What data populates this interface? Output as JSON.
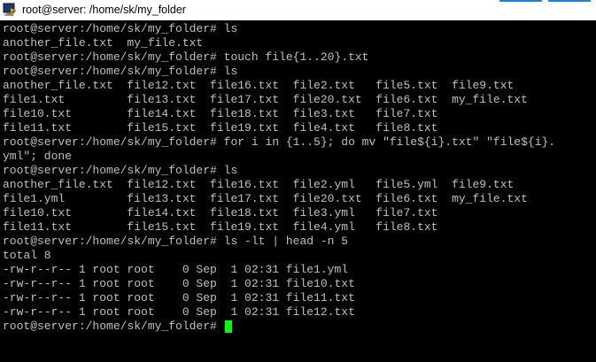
{
  "window": {
    "title": "root@server: /home/sk/my_folder",
    "accent_color": "#1f7fd6",
    "icon": "putty-terminal-icon"
  },
  "terminal": {
    "text_color": "#c0c0c0",
    "background": "#000000",
    "cursor_color": "#00ff00",
    "lines": [
      "root@server:/home/sk/my_folder# ls",
      "another_file.txt  my_file.txt",
      "root@server:/home/sk/my_folder# touch file{1..20}.txt",
      "root@server:/home/sk/my_folder# ls",
      "another_file.txt  file12.txt  file16.txt  file2.txt   file5.txt  file9.txt",
      "file1.txt         file13.txt  file17.txt  file20.txt  file6.txt  my_file.txt",
      "file10.txt        file14.txt  file18.txt  file3.txt   file7.txt",
      "file11.txt        file15.txt  file19.txt  file4.txt   file8.txt",
      "root@server:/home/sk/my_folder# for i in {1..5}; do mv \"file${i}.txt\" \"file${i}.",
      "yml\"; done",
      "root@server:/home/sk/my_folder# ls",
      "another_file.txt  file12.txt  file16.txt  file2.yml   file5.yml  file9.txt",
      "file1.yml         file13.txt  file17.txt  file20.txt  file6.txt  my_file.txt",
      "file10.txt        file14.txt  file18.txt  file3.yml   file7.txt",
      "file11.txt        file15.txt  file19.txt  file4.yml   file8.txt",
      "root@server:/home/sk/my_folder# ls -lt | head -n 5",
      "total 8",
      "-rw-r--r-- 1 root root    0 Sep  1 02:31 file1.yml",
      "-rw-r--r-- 1 root root    0 Sep  1 02:31 file10.txt",
      "-rw-r--r-- 1 root root    0 Sep  1 02:31 file11.txt",
      "-rw-r--r-- 1 root root    0 Sep  1 02:31 file12.txt"
    ],
    "prompt": "root@server:/home/sk/my_folder# "
  }
}
